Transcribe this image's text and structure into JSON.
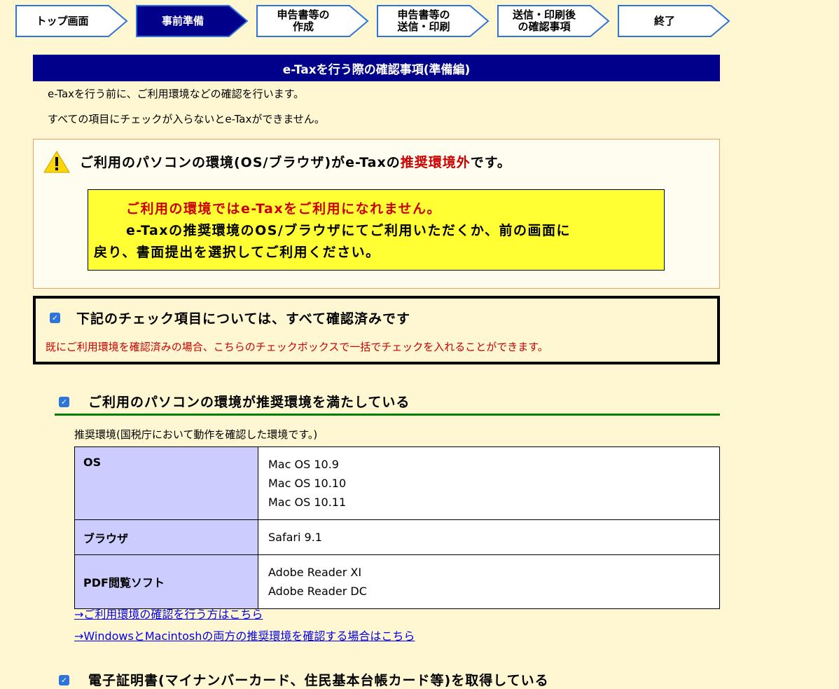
{
  "steps": [
    {
      "label": "トップ画面",
      "active": false
    },
    {
      "label": "事前準備",
      "active": true
    },
    {
      "label": "申告書等の\n作成",
      "active": false
    },
    {
      "label": "申告書等の\n送信・印刷",
      "active": false
    },
    {
      "label": "送信・印刷後\nの確認事項",
      "active": false
    },
    {
      "label": "終了",
      "active": false
    }
  ],
  "title": "e-Taxを行う際の確認事項(準備編)",
  "intro": [
    "e-Taxを行う前に、ご利用環境などの確認を行います。",
    "すべての項目にチェックが入らないとe-Taxができません。"
  ],
  "warning": {
    "icon": "warning-icon",
    "title_pre": "ご利用のパソコンの環境(OS/ブラウザ)がe-Taxの",
    "title_red": "推奨環境外",
    "title_post": "です。",
    "notice_red": "ご利用の環境ではe-Taxをご利用になれません。",
    "notice_line1": "e-Taxの推奨環境のOS/ブラウザにてご利用いただくか、前の画面に",
    "notice_line2": "戻り、書面提出を選択してご利用ください。"
  },
  "check_all": {
    "checked": true,
    "label": "下記のチェック項目については、すべて確認済みです",
    "note": "既にご利用環境を確認済みの場合、こちらのチェックボックスで一括でチェックを入れることができます。"
  },
  "section1": {
    "checked": true,
    "label": "ご利用のパソコンの環境が推奨環境を満たしている",
    "caption": "推奨環境(国税庁において動作を確認した環境です。)",
    "table": [
      {
        "header": "OS",
        "values": [
          "Mac OS 10.9",
          "Mac OS 10.10",
          "Mac OS 10.11"
        ]
      },
      {
        "header": "ブラウザ",
        "values": [
          "Safari 9.1"
        ]
      },
      {
        "header": "PDF閲覧ソフト",
        "values": [
          "Adobe Reader XI",
          "Adobe Reader DC"
        ]
      }
    ],
    "link1": "→ご利用環境の確認を行う方はこちら",
    "link2": "→WindowsとMacintoshの両方の推奨環境を確認する場合はこちら"
  },
  "section2": {
    "checked": true,
    "label": "電子証明書(マイナンバーカード、住民基本台帳カード等)を取得している"
  },
  "colors": {
    "background": "#fff7d2",
    "title_bar": "#00008b",
    "accent_red": "#cc0000",
    "notice_yellow": "#ffff33",
    "table_header": "#ccccff",
    "section_rule": "#008000",
    "checkbox": "#2f74d8"
  }
}
